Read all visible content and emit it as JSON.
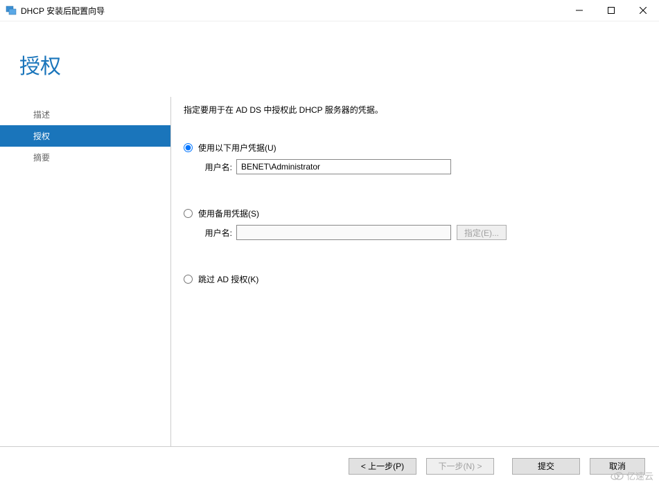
{
  "titlebar": {
    "title": "DHCP 安装后配置向导"
  },
  "header": {
    "page_title": "授权"
  },
  "sidebar": {
    "items": [
      {
        "label": "描述"
      },
      {
        "label": "授权"
      },
      {
        "label": "摘要"
      }
    ]
  },
  "main": {
    "instruction": "指定要用于在 AD DS 中授权此 DHCP 服务器的凭据。",
    "option1": {
      "label": "使用以下用户凭据(U)",
      "field_label": "用户名:",
      "field_value": "BENET\\Administrator"
    },
    "option2": {
      "label": "使用备用凭据(S)",
      "field_label": "用户名:",
      "field_value": "",
      "specify_button": "指定(E)..."
    },
    "option3": {
      "label": "跳过 AD 授权(K)"
    }
  },
  "footer": {
    "previous": "< 上一步(P)",
    "next": "下一步(N) >",
    "commit": "提交",
    "cancel": "取消"
  },
  "watermark": {
    "text": "亿速云"
  }
}
